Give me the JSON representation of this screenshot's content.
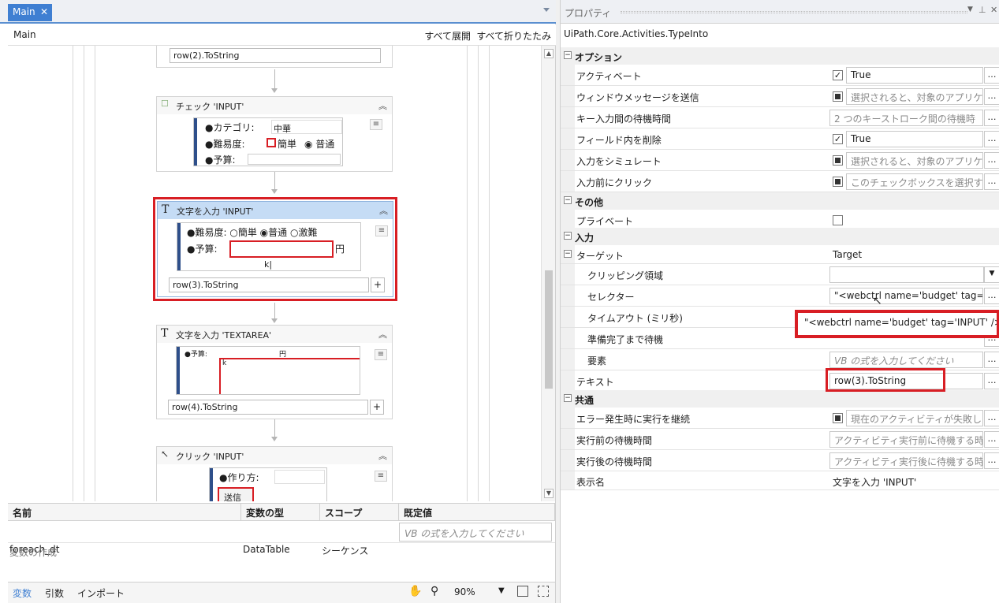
{
  "designer": {
    "tab_label": "Main",
    "tab_close": "✕",
    "breadcrumb": "Main",
    "expand_all": "すべて展開",
    "collapse_all": "すべて折りたたみ",
    "activities": {
      "top_field": "row(2).ToString",
      "check": {
        "title": "チェック 'INPUT'",
        "category_label": "●カテゴリ:",
        "category_value": "中華",
        "difficulty_label": "●難易度:",
        "easy": "簡単",
        "normal": "普通",
        "budget_label": "●予算:"
      },
      "type_input": {
        "title": "文字を入力 'INPUT'",
        "difficulty_label": "●難易度:",
        "easy": "簡単",
        "normal": "普通",
        "hard": "激難",
        "budget_label": "●予算:",
        "yen": "円",
        "field": "row(3).ToString"
      },
      "type_textarea": {
        "title": "文字を入力 'TEXTAREA'",
        "budget_label": "●予算:",
        "yen": "円",
        "field": "row(4).ToString"
      },
      "click_input": {
        "title": "クリック 'INPUT'",
        "label": "●作り方:",
        "submit": "送信"
      }
    }
  },
  "variables": {
    "headers": [
      "名前",
      "変数の型",
      "スコープ",
      "既定値"
    ],
    "rows": [
      {
        "name": "foreach_dt",
        "type": "DataTable",
        "scope": "シーケンス",
        "default_placeholder": "VB の式を入力してください"
      }
    ],
    "create_label": "変数の作成"
  },
  "bottom_bar": {
    "tabs": [
      "変数",
      "引数",
      "インポート"
    ],
    "zoom": "90%"
  },
  "properties": {
    "title": "プロパティ",
    "activity_type": "UiPath.Core.Activities.TypeInto",
    "categories": {
      "options": "オプション",
      "misc": "その他",
      "input": "入力",
      "common": "共通"
    },
    "rows": {
      "activate": {
        "label": "アクティベート",
        "value": "True"
      },
      "send_window_msg": {
        "label": "ウィンドウメッセージを送信",
        "value": "選択されると、対象のアプリケ"
      },
      "delay_between_keys": {
        "label": "キー入力間の待機時間",
        "value": "2 つのキーストローク間の待機時"
      },
      "empty_field": {
        "label": "フィールド内を削除",
        "value": "True"
      },
      "simulate": {
        "label": "入力をシミュレート",
        "value": "選択されると、対象のアプリケ"
      },
      "click_before": {
        "label": "入力前にクリック",
        "value": "このチェックボックスを選択す"
      },
      "private": {
        "label": "プライベート"
      },
      "target": {
        "label": "ターゲット",
        "value": "Target"
      },
      "clipping": {
        "label": "クリッピング領域"
      },
      "selector": {
        "label": "セレクター",
        "value": "\"<webctrl name='budget' tag="
      },
      "timeout": {
        "label": "タイムアウト (ミリ秒)"
      },
      "wait_ready": {
        "label": "準備完了まで待機"
      },
      "element": {
        "label": "要素",
        "value": "VB の式を入力してください"
      },
      "text": {
        "label": "テキスト",
        "value": "row(3).ToString"
      },
      "continue_on_error": {
        "label": "エラー発生時に実行を継続",
        "value": "現在のアクティビティが失敗し"
      },
      "delay_before": {
        "label": "実行前の待機時間",
        "value": "アクティビティ実行前に待機する時"
      },
      "delay_after": {
        "label": "実行後の待機時間",
        "value": "アクティビティ実行後に待機する時"
      },
      "display_name": {
        "label": "表示名",
        "value": "文字を入力 'INPUT'"
      }
    },
    "selector_tooltip": "\"<webctrl name='budget' tag='INPUT' />\""
  },
  "colors": {
    "accent": "#3f7fd2",
    "highlight": "#d81e24",
    "selected_header": "#c5dcf5"
  }
}
